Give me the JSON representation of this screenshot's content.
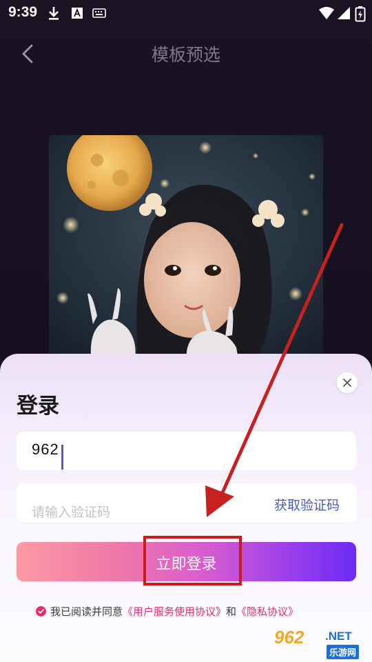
{
  "status_bar": {
    "time": "9:39",
    "icons": [
      "download-icon",
      "font-a-icon",
      "keyboard-icon",
      "wifi-icon",
      "signal-icon",
      "battery-icon"
    ]
  },
  "header": {
    "title": "模板预选",
    "back_icon": "chevron-left-icon"
  },
  "template": {
    "image_description_icon": "template-preview-image"
  },
  "login": {
    "title": "登录",
    "phone_value": "962",
    "code_placeholder": "请输入验证码",
    "get_code_label": "获取验证码",
    "submit_label": "立即登录",
    "agreement": {
      "prefix": "我已阅读并同意",
      "user_agreement": "《用户服务使用协议》",
      "conjunction": "和",
      "privacy_policy": "《隐私协议》",
      "checked": true
    }
  },
  "watermark": {
    "logo": "962",
    "suffix": ".NET",
    "sub": "乐游网"
  },
  "colors": {
    "accent_pink": "#e0306a",
    "link_blue": "#4b5bbd",
    "annotation_red": "#cf1a1a"
  }
}
